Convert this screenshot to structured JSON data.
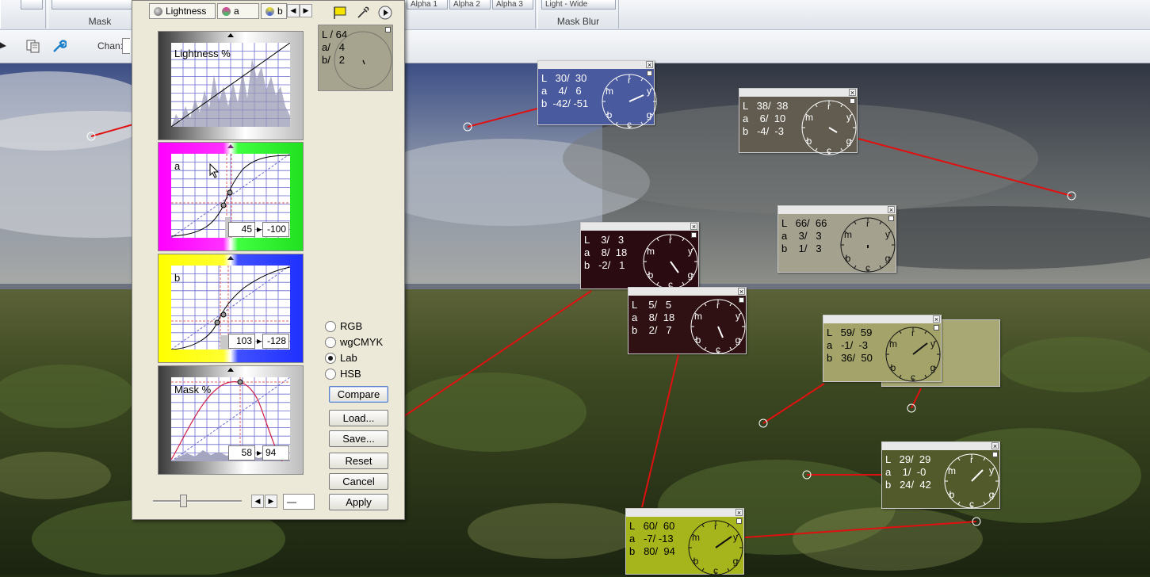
{
  "ribbon": {
    "mask_group_label": "Mask",
    "mask_blur_group_label": "Mask Blur",
    "alpha_buttons": [
      "Alpha 1",
      "Alpha 2",
      "Alpha 3"
    ],
    "light_wide_label": "Light - Wide"
  },
  "toolbar": {
    "chan_label": "Chan:"
  },
  "dialog": {
    "tabs": [
      {
        "label": "Lightness",
        "dot_color": "#666666"
      },
      {
        "label": "a",
        "dot_color": "#c04890"
      },
      {
        "label": "b",
        "dot_color": "#7aa050"
      }
    ],
    "panels": {
      "lightness": {
        "label": "Lightness %"
      },
      "a": {
        "label": "a",
        "input_value": "45",
        "output_value": "-100"
      },
      "b": {
        "label": "b",
        "input_value": "103",
        "output_value": "-128"
      },
      "mask": {
        "label": "Mask %",
        "input_value": "58",
        "output_value": "94"
      }
    },
    "sample": {
      "L_label": "L /",
      "L_value": "64",
      "a_label": "a/",
      "a_value": "4",
      "b_label": "b/",
      "b_value": "2"
    },
    "color_modes": [
      {
        "label": "RGB",
        "selected": false
      },
      {
        "label": "wgCMYK",
        "selected": false
      },
      {
        "label": "Lab",
        "selected": true
      },
      {
        "label": "HSB",
        "selected": false
      }
    ],
    "buttons": {
      "compare": "Compare",
      "load": "Load...",
      "save": "Save...",
      "reset": "Reset",
      "cancel": "Cancel",
      "apply": "Apply"
    },
    "zoom_value": "—"
  },
  "readouts": [
    {
      "L": "L   30/  30",
      "a": "a    4/   6",
      "b": "b  -42/ -51",
      "bg": "#4a5a9e"
    },
    {
      "L": "L   38/  38",
      "a": "a    6/  10",
      "b": "b   -4/  -3",
      "bg": "#615c4f"
    },
    {
      "L": "L   66/  66",
      "a": "a    3/   3",
      "b": "b    1/   3",
      "bg": "#a4a18f"
    },
    {
      "L": "L    3/   3",
      "a": "a    8/  18",
      "b": "b   -2/   1",
      "bg": "#2b0b12"
    },
    {
      "L": "L    5/   5",
      "a": "a    8/  18",
      "b": "b    2/   7",
      "bg": "#2f1113"
    },
    {
      "L": "L   59/  59",
      "a": "a   -1/  -3",
      "b": "b   36/  50",
      "bg": "#a3a36a"
    },
    {
      "L": "L   29/  29",
      "a": "a    1/  -0",
      "b": "b   24/  42",
      "bg": "#525a2c"
    },
    {
      "L": "L   60/  60",
      "a": "a   -7/ -13",
      "b": "b   80/  94",
      "bg": "#a6b51c"
    }
  ],
  "dial_labels": {
    "r": "r",
    "y": "y",
    "m": "m",
    "g": "g",
    "b": "b",
    "c": "c"
  }
}
